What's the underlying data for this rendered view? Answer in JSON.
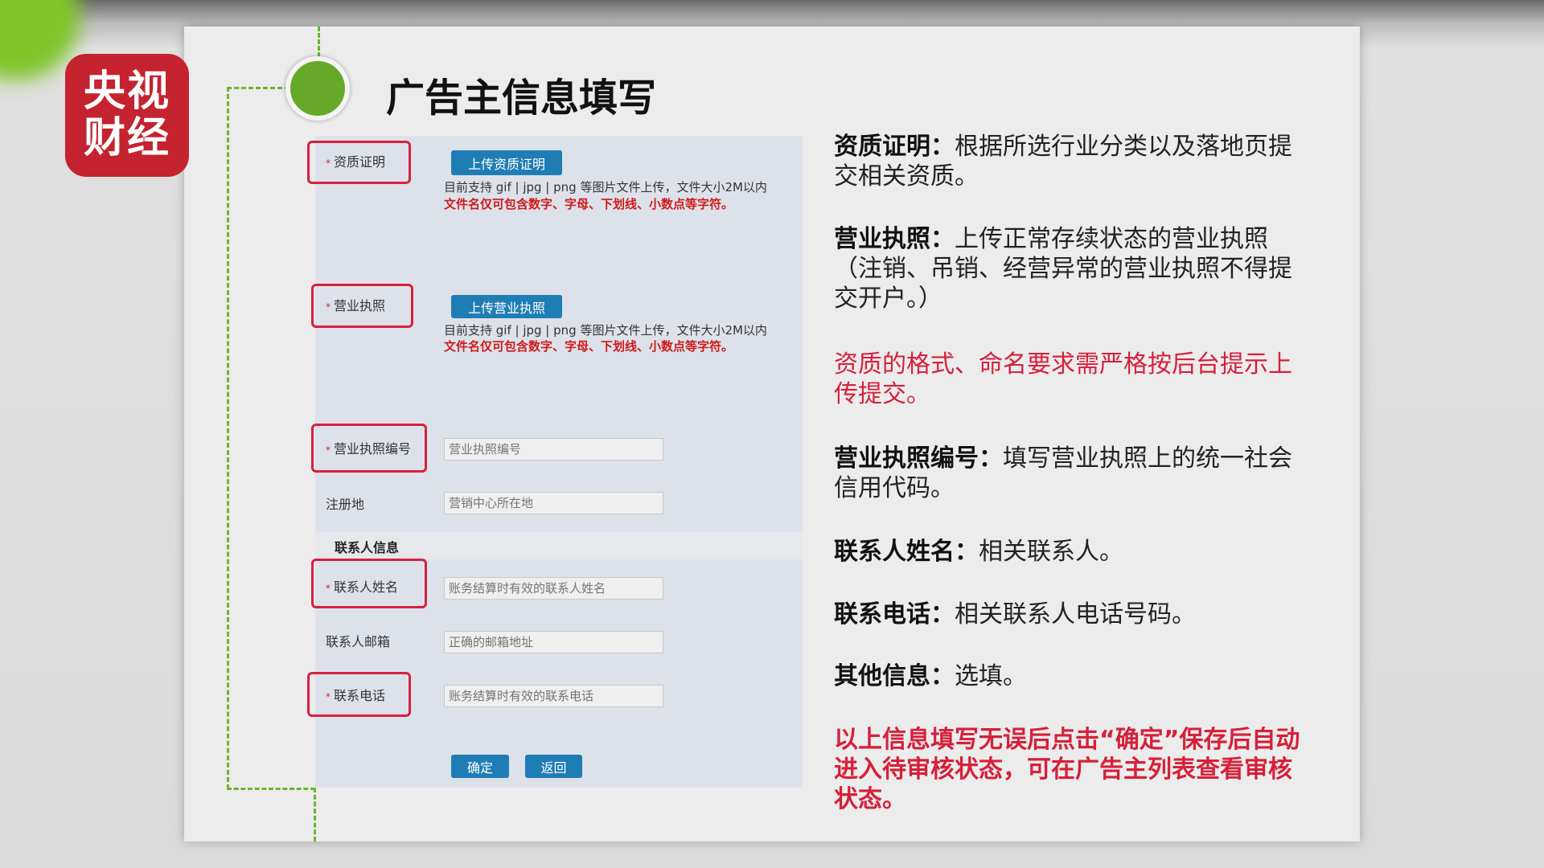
{
  "logo": {
    "line1": "央视",
    "line2": "财经"
  },
  "title": "广告主信息填写",
  "form": {
    "qualification": {
      "label": "资质证明",
      "button": "上传资质证明",
      "hint": "目前支持 gif | jpg | png 等图片文件上传，文件大小2M以内",
      "rule": "文件名仅可包含数字、字母、下划线、小数点等字符。"
    },
    "license": {
      "label": "营业执照",
      "button": "上传营业执照",
      "hint": "目前支持 gif | jpg | png 等图片文件上传，文件大小2M以内",
      "rule": "文件名仅可包含数字、字母、下划线、小数点等字符。"
    },
    "license_no": {
      "label": "营业执照编号",
      "placeholder": "营业执照编号"
    },
    "reg_addr": {
      "label": "注册地",
      "placeholder": "营销中心所在地"
    },
    "contact_section": "联系人信息",
    "contact_name": {
      "label": "联系人姓名",
      "placeholder": "账务结算时有效的联系人姓名"
    },
    "contact_email": {
      "label": "联系人邮箱",
      "placeholder": "正确的邮箱地址"
    },
    "contact_phone": {
      "label": "联系电话",
      "placeholder": "账务结算时有效的联系电话"
    },
    "required_mark": "*",
    "confirm": "确定",
    "back": "返回"
  },
  "notes": [
    {
      "term": "资质证明：",
      "text": "根据所选行业分类以及落地页提交相关资质。"
    },
    {
      "term": "营业执照：",
      "text": "上传正常存续状态的营业执照（注销、吊销、经营异常的营业执照不得提交开户。）"
    },
    {
      "term": "",
      "text": "资质的格式、命名要求需严格按后台提示上传提交。"
    },
    {
      "term": "营业执照编号：",
      "text": "填写营业执照上的统一社会信用代码。"
    },
    {
      "term": "联系人姓名：",
      "text": "相关联系人。"
    },
    {
      "term": "联系电话：",
      "text": "相关联系人电话号码。"
    },
    {
      "term": "其他信息：",
      "text": "选填。"
    },
    {
      "term": "",
      "text": "以上信息填写无误后点击“确定”保存后自动进入待审核状态，可在广告主列表查看审核状态。"
    }
  ]
}
